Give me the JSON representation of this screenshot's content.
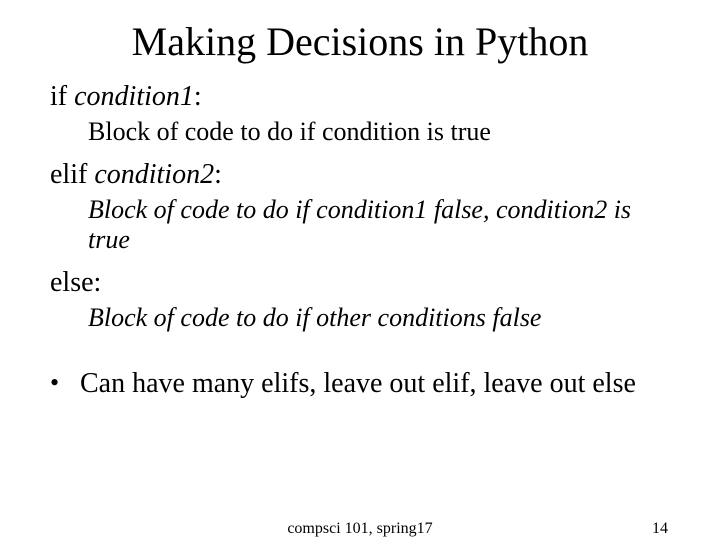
{
  "title": "Making Decisions in Python",
  "if_line": {
    "keyword": "if ",
    "cond": "condition1",
    "colon": ":"
  },
  "if_body": "Block of code to do if condition is true",
  "elif_line": {
    "keyword": "elif ",
    "cond": "condition2",
    "colon": ":"
  },
  "elif_body_prefix": "Block of code to do if condition1 false, condition2 is true",
  "else_line": "else:",
  "else_body": "Block of code to do if other conditions false",
  "bullet": "Can have many elifs, leave out elif, leave out else",
  "footer_center": "compsci 101, spring17",
  "footer_right": "14"
}
